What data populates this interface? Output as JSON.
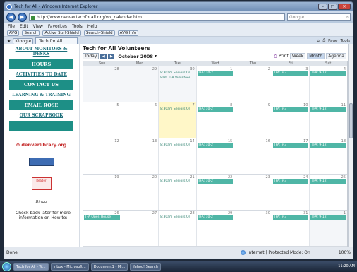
{
  "window": {
    "title": "Tech for All - Windows Internet Explorer",
    "minimize": "–",
    "maximize": "□",
    "close": "✕"
  },
  "address": {
    "url": "http://www.denvertechforall.org/vol_calendar.htm",
    "search_placeholder": "Google"
  },
  "menu": [
    "File",
    "Edit",
    "View",
    "Favorites",
    "Tools",
    "Help"
  ],
  "toolbar": {
    "avg": "AVG",
    "search": "Search",
    "active_surf": "Active Surf-Shield",
    "search_shield": "Search-Shield",
    "avg_info": "AVG Info",
    "igoogle": "iGoogle"
  },
  "tabs": {
    "current": "Tech for All",
    "page_menu": "Page",
    "tools_menu": "Tools"
  },
  "sidebar": {
    "top_link": "ABOUT MONITORS & DESKS",
    "items": [
      {
        "label": "HOURS",
        "style": "block"
      },
      {
        "label": "ACTIVITIES TO DATE",
        "style": "link"
      },
      {
        "label": "CONTACT US",
        "style": "block"
      },
      {
        "label": "LEARNING & TRAINING",
        "style": "link"
      },
      {
        "label": "EMAIL ROSE",
        "style": "block"
      },
      {
        "label": "OUR SCRAPBOOK",
        "style": "link"
      }
    ],
    "logo_denverlibrary": "denverlibrary.org",
    "logo_reader": "Reader",
    "logo_bingo": "Bingo",
    "check_back": "Check back later for more information on How to:"
  },
  "calendar": {
    "title": "Tech for All Volunteers",
    "today": "Today",
    "prev": "◀",
    "next": "▶",
    "month": "October 2008",
    "print": "Print",
    "views": [
      "Week",
      "Month",
      "Agenda"
    ],
    "active_view": "Month",
    "weekdays": [
      "Sun",
      "Mon",
      "Tue",
      "Wed",
      "Thu",
      "Fri",
      "Sat"
    ],
    "weeks": [
      [
        {
          "n": "28",
          "o": true
        },
        {
          "n": "29",
          "o": true
        },
        {
          "n": "30",
          "o": true,
          "e": [
            {
              "t": "8:30am Seniors On",
              "k": "txt"
            },
            {
              "t": "8am TFA Volunteer",
              "k": "txt"
            }
          ]
        },
        {
          "n": "1",
          "e": [
            {
              "t": "TFA: 10-2",
              "k": "bar"
            }
          ]
        },
        {
          "n": "2"
        },
        {
          "n": "3",
          "e": [
            {
              "t": "TFA: 9-3",
              "k": "bar"
            }
          ]
        },
        {
          "n": "4",
          "e": [
            {
              "t": "TFA: 9-12",
              "k": "bar"
            }
          ]
        }
      ],
      [
        {
          "n": "5"
        },
        {
          "n": "6"
        },
        {
          "n": "7",
          "today": true,
          "e": [
            {
              "t": "8:30am Seniors On",
              "k": "txt"
            }
          ]
        },
        {
          "n": "8",
          "e": [
            {
              "t": "TFA: 10-2",
              "k": "bar"
            }
          ]
        },
        {
          "n": "9"
        },
        {
          "n": "10",
          "e": [
            {
              "t": "TFA: 9-3",
              "k": "bar"
            }
          ]
        },
        {
          "n": "11",
          "e": [
            {
              "t": "TFA: 9-12",
              "k": "bar"
            }
          ]
        }
      ],
      [
        {
          "n": "12"
        },
        {
          "n": "13"
        },
        {
          "n": "14",
          "e": [
            {
              "t": "8:30am Seniors On",
              "k": "txt"
            }
          ]
        },
        {
          "n": "15",
          "e": [
            {
              "t": "TFA: 10-2",
              "k": "bar"
            }
          ]
        },
        {
          "n": "16"
        },
        {
          "n": "17",
          "e": [
            {
              "t": "TFA: 9-3",
              "k": "bar"
            }
          ]
        },
        {
          "n": "18",
          "e": [
            {
              "t": "TFA: 9-12",
              "k": "bar"
            }
          ]
        }
      ],
      [
        {
          "n": "19"
        },
        {
          "n": "20"
        },
        {
          "n": "21",
          "e": [
            {
              "t": "8:30am Seniors On",
              "k": "txt"
            }
          ]
        },
        {
          "n": "22",
          "e": [
            {
              "t": "TFA: 10-2",
              "k": "bar"
            }
          ]
        },
        {
          "n": "23"
        },
        {
          "n": "24",
          "e": [
            {
              "t": "TFA: 9-3",
              "k": "bar"
            }
          ]
        },
        {
          "n": "25",
          "e": [
            {
              "t": "TFA: 9-12",
              "k": "bar"
            }
          ]
        }
      ],
      [
        {
          "n": "26",
          "e": [
            {
              "t": "TFA Open House",
              "k": "bar"
            }
          ]
        },
        {
          "n": "27"
        },
        {
          "n": "28",
          "e": [
            {
              "t": "8:30am Seniors On",
              "k": "txt"
            }
          ]
        },
        {
          "n": "29",
          "e": [
            {
              "t": "TFA: 10-2",
              "k": "bar"
            }
          ]
        },
        {
          "n": "30"
        },
        {
          "n": "31",
          "e": [
            {
              "t": "TFA: 9-3",
              "k": "bar"
            }
          ]
        },
        {
          "n": "1",
          "o": true,
          "e": [
            {
              "t": "TFA: 9-12",
              "k": "bar"
            }
          ]
        }
      ]
    ]
  },
  "status": {
    "left": "Done",
    "zone": "Internet | Protected Mode: On",
    "zoom": "100%"
  },
  "taskbar": {
    "tasks": [
      "Tech for All - W...",
      "Inbox - Microsoft...",
      "Document1 - Mi...",
      "Yahoo! Search"
    ],
    "active": 0,
    "clock": "11:20 AM"
  },
  "colors": {
    "accent": "#1d8f86",
    "event_bar": "#4fb6a6",
    "today": "#fff7c8"
  }
}
